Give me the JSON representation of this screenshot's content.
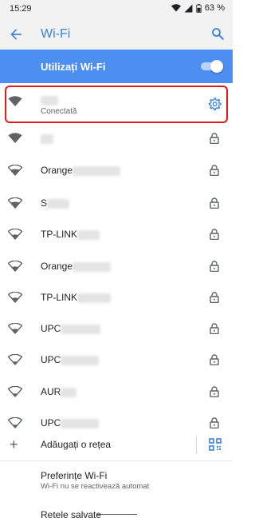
{
  "status_bar": {
    "time": "15:29",
    "battery": "63 %"
  },
  "header": {
    "title": "Wi-Fi"
  },
  "master_switch": {
    "label": "Utilizați Wi-Fi",
    "enabled": true
  },
  "connected_network": {
    "status": "Conectată"
  },
  "networks": [
    {
      "prefix": "",
      "signal": "full"
    },
    {
      "prefix": "Orange",
      "signal": "high"
    },
    {
      "prefix": "S",
      "signal": "high"
    },
    {
      "prefix": "TP-LINK",
      "signal": "medium"
    },
    {
      "prefix": "Orange",
      "signal": "medium"
    },
    {
      "prefix": "TP-LINK",
      "signal": "medium"
    },
    {
      "prefix": "UPC",
      "signal": "medium"
    },
    {
      "prefix": "UPC",
      "signal": "low"
    },
    {
      "prefix": "AUR",
      "signal": "low"
    },
    {
      "prefix": "UPC",
      "signal": "low"
    }
  ],
  "add_network": {
    "label": "Adăugați o rețea"
  },
  "preferences": {
    "title": "Preferințe Wi-Fi",
    "subtitle": "Wi-Fi nu se reactivează automat"
  },
  "saved_networks": {
    "title": "Rețele salvate"
  },
  "colors": {
    "accent": "#4c8ff0",
    "header_text": "#3b82d9",
    "highlight": "#e21a1a"
  }
}
